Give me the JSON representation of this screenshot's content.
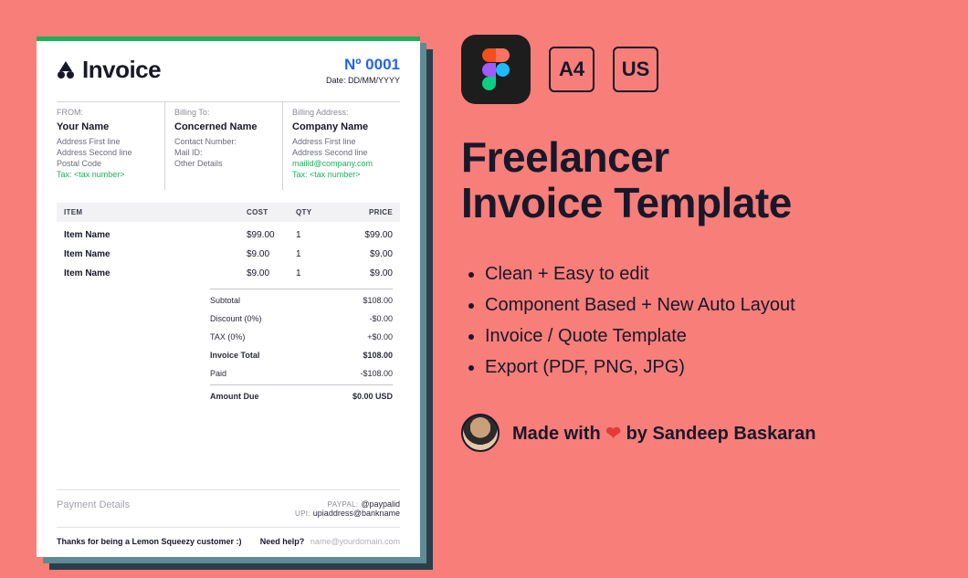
{
  "invoice": {
    "title": "Invoice",
    "number_label": "Nº 0001",
    "date_label": "Date: DD/MM/YYYY",
    "from": {
      "label": "FROM:",
      "name": "Your Name",
      "line1": "Address First line",
      "line2": "Address Second line",
      "line3": "Postal Code",
      "tax": "Tax: <tax number>"
    },
    "billing_to": {
      "label": "Billing To:",
      "name": "Concerned Name",
      "line1": "Contact Number:",
      "line2": "Mail ID:",
      "line3": "Other Details"
    },
    "billing_address": {
      "label": "Billing Address:",
      "name": "Company Name",
      "line1": "Address First line",
      "line2": "Address Second line",
      "mail": "mailid@company.com",
      "tax": "Tax: <tax number>"
    },
    "columns": {
      "item": "ITEM",
      "cost": "COST",
      "qty": "QTY",
      "price": "PRICE"
    },
    "items": [
      {
        "name": "Item Name",
        "cost": "$99.00",
        "qty": "1",
        "price": "$99.00"
      },
      {
        "name": "Item Name",
        "cost": "$9.00",
        "qty": "1",
        "price": "$9.00"
      },
      {
        "name": "Item Name",
        "cost": "$9.00",
        "qty": "1",
        "price": "$9.00"
      }
    ],
    "totals": {
      "subtotal_label": "Subtotal",
      "subtotal_value": "$108.00",
      "discount_label": "Discount (0%)",
      "discount_value": "-$0.00",
      "tax_label": "TAX (0%)",
      "tax_value": "+$0.00",
      "total_label": "Invoice Total",
      "total_value": "$108.00",
      "paid_label": "Paid",
      "paid_value": "-$108.00",
      "due_label": "Amount Due",
      "due_value": "$0.00 USD"
    },
    "payment": {
      "title": "Payment Details",
      "paypal_key": "PAYPAL:",
      "paypal_val": "@paypalid",
      "upi_key": "UPI:",
      "upi_val": "upiaddress@bankname"
    },
    "footer": {
      "thanks": "Thanks for being a Lemon Squeezy customer :)",
      "need_help": "Need help?",
      "help_mail": "name@yourdomain.com"
    }
  },
  "promo": {
    "size_a4": "A4",
    "size_us": "US",
    "headline_l1": "Freelancer",
    "headline_l2": "Invoice Template",
    "bullets": [
      "Clean + Easy to edit",
      "Component Based + New Auto Layout",
      "Invoice / Quote Template",
      "Export (PDF, PNG, JPG)"
    ],
    "made_prefix": "Made with",
    "made_suffix": "by Sandeep Baskaran"
  }
}
